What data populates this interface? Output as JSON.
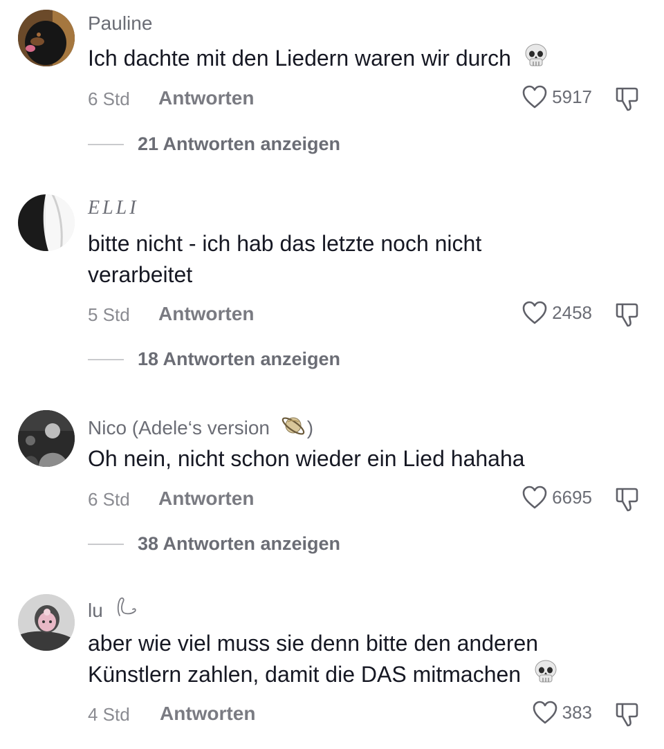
{
  "comments": [
    {
      "username": "Pauline",
      "text": "Ich dachte mit den Liedern waren wir durch",
      "time": "6 Std",
      "reply_label": "Antworten",
      "likes": "5917",
      "view_replies": "21 Antworten anzeigen",
      "emoji": "skull-icon"
    },
    {
      "username": "ELLI",
      "text": "bitte nicht - ich hab das letzte noch nicht verarbeitet",
      "time": "5 Std",
      "reply_label": "Antworten",
      "likes": "2458",
      "view_replies": "18 Antworten anzeigen"
    },
    {
      "username": "Nico (Adele‘s version",
      "username_suffix": ")",
      "username_emoji": "ringed-planet-icon",
      "text": "Oh nein, nicht schon wieder ein Lied hahaha",
      "time": "6 Std",
      "reply_label": "Antworten",
      "likes": "6695",
      "view_replies": "38 Antworten anzeigen"
    },
    {
      "username": "lu",
      "username_emoji": "swan-outline-icon",
      "text": "aber wie viel muss sie denn bitte den anderen Künstlern zahlen, damit die DAS mitmachen",
      "time": "4 Std",
      "reply_label": "Antworten",
      "likes": "383",
      "emoji": "skull-icon"
    }
  ],
  "colors": {
    "text_primary": "#161823",
    "text_secondary": "#6b6d75",
    "meta": "#8a8b91",
    "divider": "#c9cacd"
  }
}
